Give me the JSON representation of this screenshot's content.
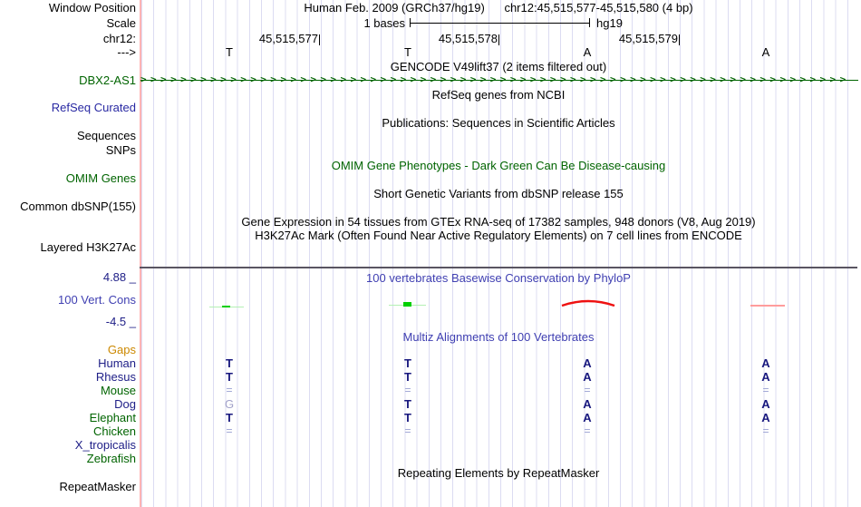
{
  "header": {
    "assembly": "Human Feb. 2009 (GRCh37/hg19)",
    "position": "chr12:45,515,577-45,515,580 (4 bp)",
    "window_position_label": "Window Position",
    "scale_label": "Scale",
    "scale_value": "1 bases",
    "assembly_tag": "hg19",
    "chrom_label": "chr12:",
    "strand_label": "--->",
    "ruler_ticks": [
      "45,515,577",
      "45,515,578",
      "45,515,579"
    ],
    "bases": [
      "T",
      "T",
      "A",
      "A"
    ]
  },
  "tracks": {
    "gencode": {
      "title": "GENCODE V49lift37 (2 items filtered out)",
      "gene_label": "DBX2-AS1"
    },
    "refseq": {
      "title": "RefSeq genes from NCBI",
      "label": "RefSeq Curated"
    },
    "publications": {
      "title": "Publications: Sequences in Scientific Articles",
      "label_sequences": "Sequences",
      "label_snps": "SNPs"
    },
    "omim": {
      "title": "OMIM Gene Phenotypes - Dark Green Can Be Disease-causing",
      "label": "OMIM Genes"
    },
    "dbsnp": {
      "title": "Short Genetic Variants from dbSNP release 155",
      "label": "Common dbSNP(155)"
    },
    "gtex": {
      "title": "Gene Expression in 54 tissues from GTEx RNA-seq of 17382 samples, 948 donors (V8, Aug 2019)"
    },
    "h3k27ac": {
      "title": "H3K27Ac Mark (Often Found Near Active Regulatory Elements) on 7 cell lines from ENCODE",
      "label": "Layered H3K27Ac"
    },
    "phylop": {
      "title": "100 vertebrates Basewise Conservation by PhyloP",
      "label": "100 Vert. Cons",
      "axis_max": "4.88 _",
      "axis_min": "-4.5 _",
      "marks": [
        {
          "base": 1,
          "shape": "small-dash",
          "color": "#00d000"
        },
        {
          "base": 2,
          "shape": "square",
          "color": "#00d000"
        },
        {
          "base": 3,
          "shape": "arch",
          "color": "#ee1111"
        },
        {
          "base": 4,
          "shape": "thin-line",
          "color": "#ff9c9c"
        }
      ]
    },
    "multiz": {
      "title": "Multiz Alignments of 100 Vertebrates",
      "rows": [
        {
          "label": "Gaps",
          "cells": [
            "",
            "",
            "",
            ""
          ]
        },
        {
          "label": "Human",
          "cells": [
            "T",
            "T",
            "A",
            "A"
          ]
        },
        {
          "label": "Rhesus",
          "cells": [
            "T",
            "T",
            "A",
            "A"
          ]
        },
        {
          "label": "Mouse",
          "cells": [
            "=",
            "=",
            "=",
            "="
          ]
        },
        {
          "label": "Dog",
          "cells": [
            "G",
            "T",
            "A",
            "A"
          ]
        },
        {
          "label": "Elephant",
          "cells": [
            "T",
            "T",
            "A",
            "A"
          ]
        },
        {
          "label": "Chicken",
          "cells": [
            "=",
            "=",
            "=",
            "="
          ]
        },
        {
          "label": "X_tropicalis",
          "cells": [
            "",
            "",
            "",
            ""
          ]
        },
        {
          "label": "Zebrafish",
          "cells": [
            "",
            "",
            "",
            ""
          ]
        }
      ]
    },
    "repeatmasker": {
      "title": "Repeating Elements by RepeatMasker",
      "label": "RepeatMasker"
    }
  },
  "colors": {
    "green_label": "#006400",
    "blue_title": "#4040b2",
    "navy_label": "#202088",
    "orange_label": "#cc8800",
    "gridline": "#dcdcf2",
    "image_left_border": "#ffb4b4",
    "separator": "#5a5562",
    "cons_positive_green": "#00d000",
    "cons_negative_red": "#ee1111",
    "cons_negative_pink": "#ff9c9c"
  }
}
